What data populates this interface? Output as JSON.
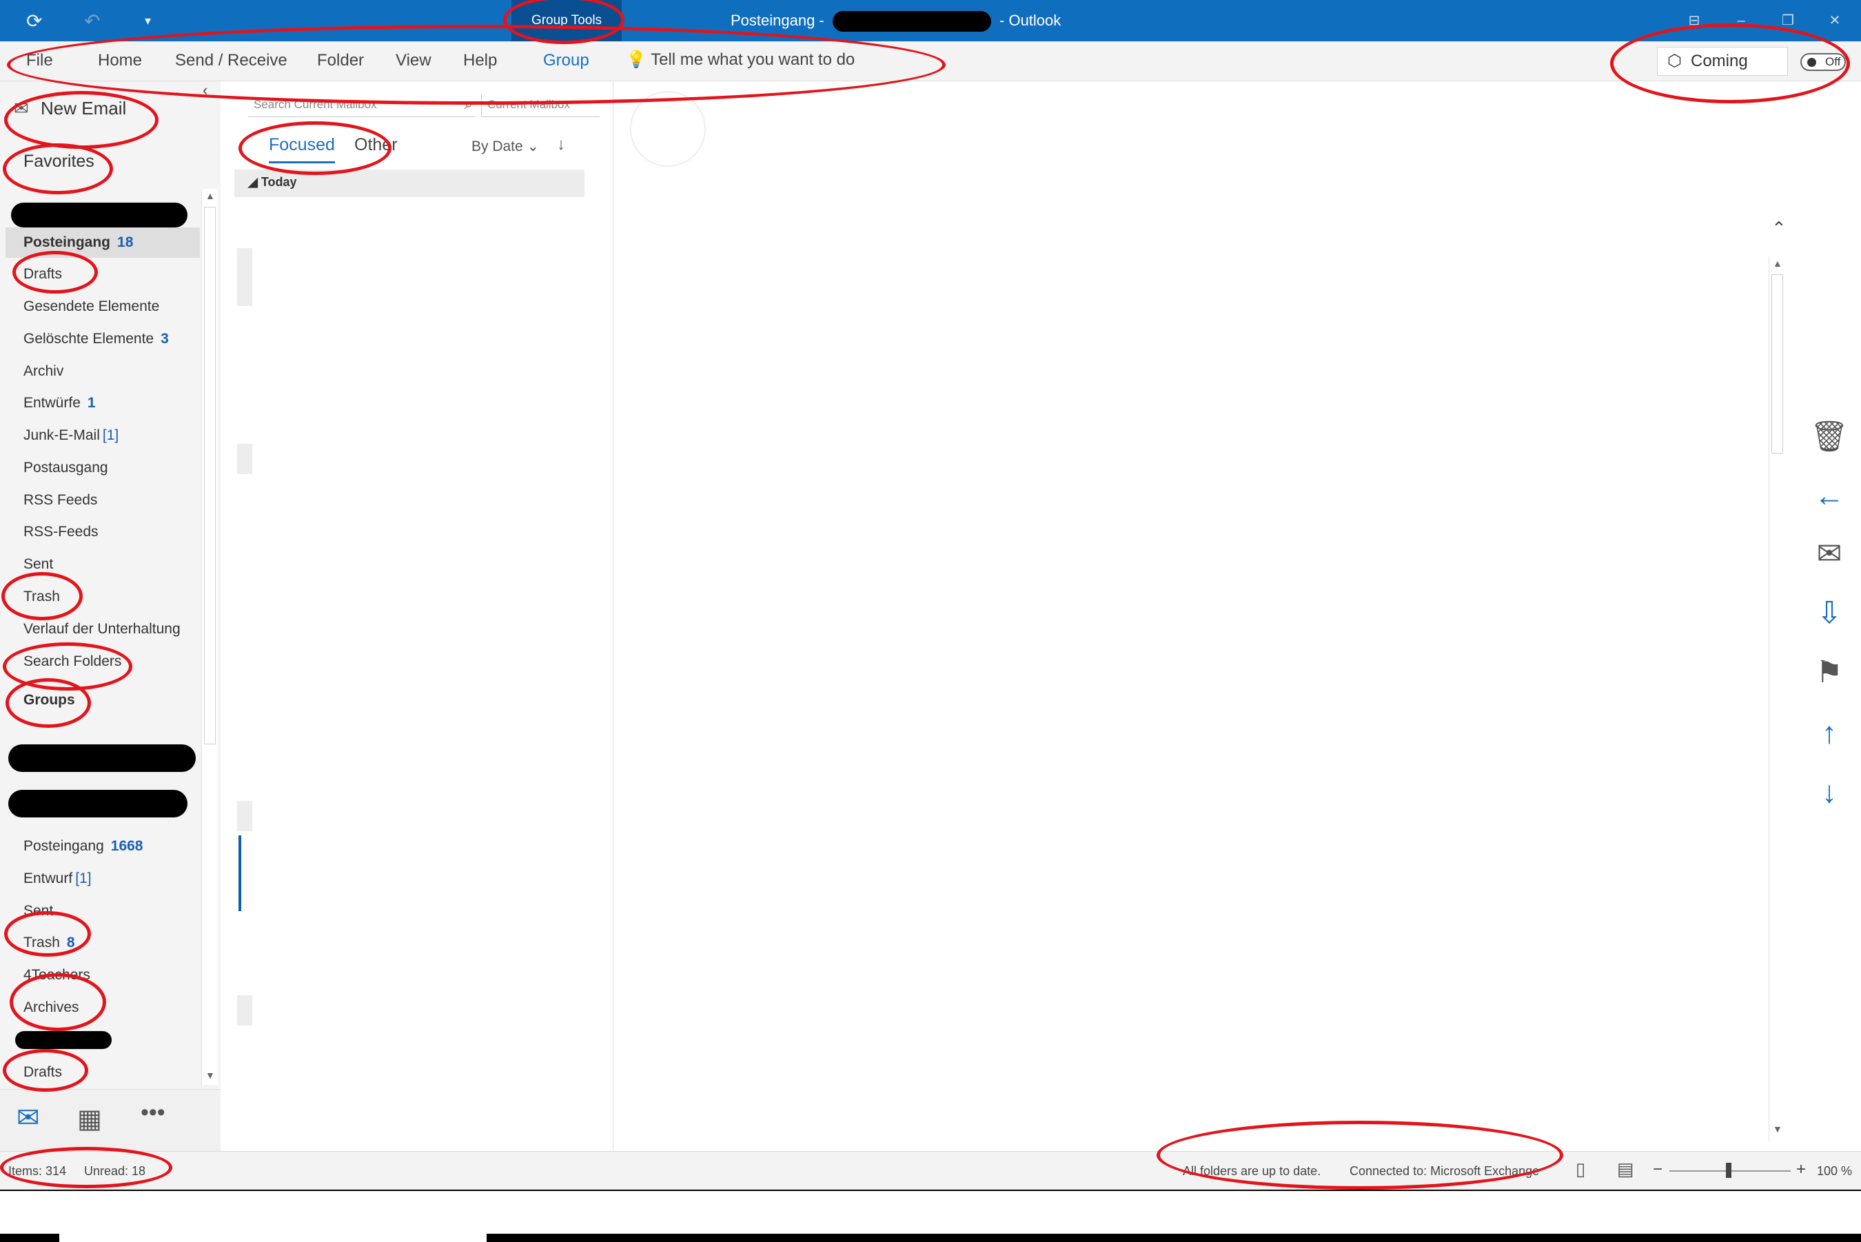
{
  "window": {
    "title_prefix": "Posteingang -",
    "title_suffix": "- Outlook",
    "contextual_tab": "Group Tools"
  },
  "ribbon": {
    "tabs": [
      "File",
      "Home",
      "Send / Receive",
      "Folder",
      "View",
      "Help",
      "Group"
    ],
    "tell_me": "Tell me what you want to do",
    "coming_soon": "Coming Soon",
    "toggle_label": "Off"
  },
  "folder_pane": {
    "new_email": "New Email",
    "favorites": "Favorites",
    "folders": [
      {
        "label": "Posteingang",
        "count": "18"
      },
      {
        "label": "Drafts"
      },
      {
        "label": "Gesendete Elemente"
      },
      {
        "label": "Gelöschte Elemente",
        "count": "3"
      },
      {
        "label": "Archiv"
      },
      {
        "label": "Entwürfe",
        "count": "1"
      },
      {
        "label": "Junk-E-Mail",
        "count_br": "[1]"
      },
      {
        "label": "Postausgang"
      },
      {
        "label": "RSS Feeds"
      },
      {
        "label": "RSS-Feeds"
      },
      {
        "label": "Sent"
      },
      {
        "label": "Trash"
      },
      {
        "label": "Verlauf der Unterhaltung"
      },
      {
        "label": "Search Folders"
      }
    ],
    "groups_header": "Groups",
    "group_folders": [
      {
        "label": "Posteingang",
        "count": "1668"
      },
      {
        "label": "Entwurf",
        "count_br": "[1]"
      },
      {
        "label": "Sent"
      },
      {
        "label": "Trash",
        "count": "8"
      },
      {
        "label": "4Teachers"
      },
      {
        "label": "Archives"
      },
      {
        "label": "Drafts"
      }
    ]
  },
  "message_list": {
    "search_placeholder": "Search Current Mailbox",
    "scope": "Current Mailbox",
    "focused": "Focused",
    "other": "Other",
    "sort_by": "By Date",
    "group_today": "Today"
  },
  "status_bar": {
    "items": "Items: 314",
    "unread": "Unread: 18",
    "sync_status": "All folders are up to date.",
    "connection": "Connected to: Microsoft Exchange",
    "zoom": "100 %"
  },
  "colors": {
    "accent": "#106ebe",
    "link_blue": "#1a5fb4",
    "annotation_red": "#e3141b"
  }
}
